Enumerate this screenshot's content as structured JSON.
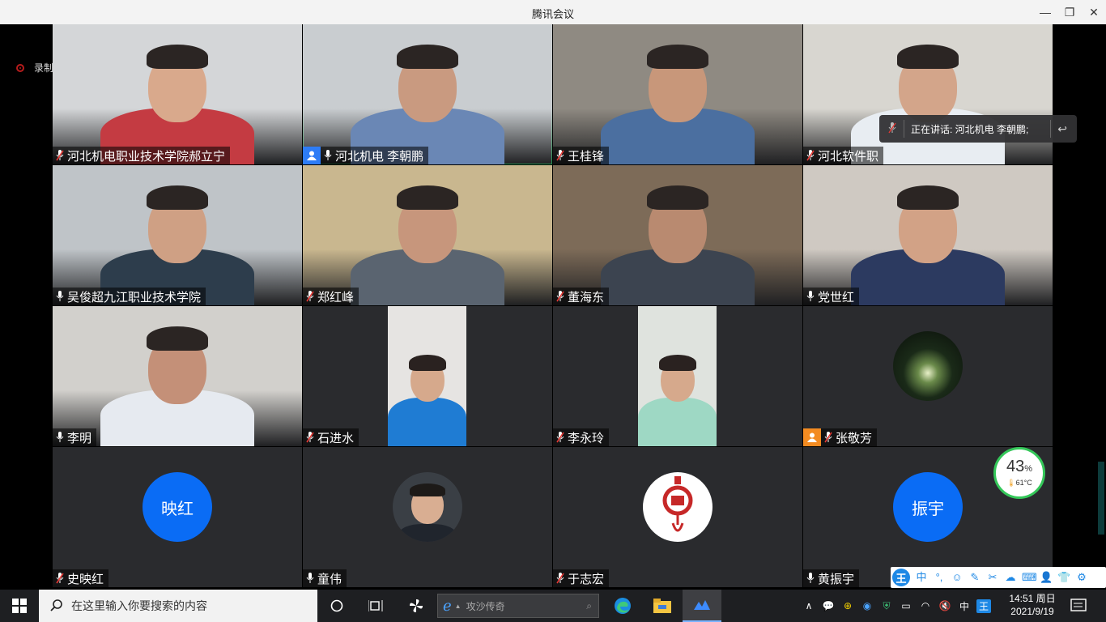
{
  "window": {
    "title": "腾讯会议",
    "minimize": "—",
    "restore": "❐",
    "close": "✕"
  },
  "recording": {
    "label": "录制中"
  },
  "speaker_toast": {
    "text": "正在讲话: 河北机电 李朝鹏;"
  },
  "tiles": [
    {
      "name": "河北机电职业技术学院郝立宁",
      "mic": "muted",
      "kind": "video",
      "bg": "#d4d6d8"
    },
    {
      "name": "河北机电 李朝鹏",
      "mic": "on",
      "kind": "video",
      "badge": "host",
      "active": true,
      "bg": "#c9cdd0"
    },
    {
      "name": "王桂锋",
      "mic": "muted",
      "kind": "video",
      "bg": "#8f8a82"
    },
    {
      "name": "河北软件职",
      "mic": "muted",
      "kind": "video",
      "bg": "#d8d6d0"
    },
    {
      "name": "吴俊超九江职业技术学院",
      "mic": "on",
      "kind": "video",
      "bg": "#bfc4c8"
    },
    {
      "name": "郑红峰",
      "mic": "muted",
      "kind": "video",
      "bg": "#c9b78f"
    },
    {
      "name": "董海东",
      "mic": "muted",
      "kind": "video",
      "bg": "#7d6b58"
    },
    {
      "name": "党世红",
      "mic": "on",
      "kind": "video",
      "bg": "#cfc9c2"
    },
    {
      "name": "李明",
      "mic": "on",
      "kind": "video",
      "bg": "#d2d0cc"
    },
    {
      "name": "石进水",
      "mic": "muted",
      "kind": "portrait",
      "bg": "#e6e4e2"
    },
    {
      "name": "李永玲",
      "mic": "muted",
      "kind": "portrait",
      "bg": "#dfe3de"
    },
    {
      "name": "张敬芳",
      "mic": "muted",
      "kind": "avatar-photo",
      "badge": "orange"
    },
    {
      "name": "史映红",
      "mic": "muted",
      "kind": "avatar-text",
      "avatar_text": "映红"
    },
    {
      "name": "童伟",
      "mic": "on",
      "kind": "avatar-photo"
    },
    {
      "name": "于志宏",
      "mic": "muted",
      "kind": "avatar-logo"
    },
    {
      "name": "黄振宇",
      "mic": "on",
      "kind": "avatar-text",
      "avatar_text": "振宇"
    }
  ],
  "temp_widget": {
    "percent": "43",
    "percent_sign": "%",
    "temp": "61°C"
  },
  "ime": {
    "logo": "王",
    "mode": "中"
  },
  "taskbar": {
    "search_placeholder": "在这里输入你要搜索的内容",
    "ie_search": "攻沙传奇",
    "tray_lang": "中",
    "tray_ime": "王",
    "time": "14:51 周日",
    "date": "2021/9/19"
  }
}
